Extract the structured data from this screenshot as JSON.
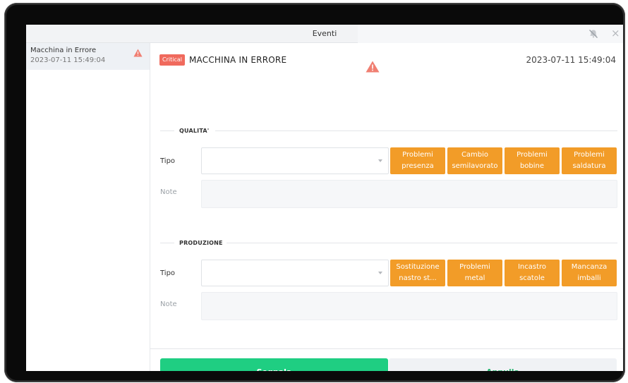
{
  "window": {
    "title": "Eventi"
  },
  "sidebar": {
    "items": [
      {
        "name": "Macchina in Errore",
        "time": "2023-07-11 15:49:04"
      }
    ]
  },
  "event": {
    "badge": "Critical",
    "title": "MACCHINA IN ERRORE",
    "time": "2023-07-11 15:49:04"
  },
  "quality": {
    "section": "QUALITA'",
    "type_label": "Tipo",
    "type_value": "",
    "note_label": "Note",
    "note_value": "",
    "buttons": [
      {
        "label": "Problemi presenza"
      },
      {
        "label": "Cambio semilavorato"
      },
      {
        "label": "Problemi bobine"
      },
      {
        "label": "Problemi saldatura"
      }
    ]
  },
  "production": {
    "section": "PRODUZIONE",
    "type_label": "Tipo",
    "type_value": "",
    "note_label": "Note",
    "note_value": "",
    "buttons": [
      {
        "label": "Sostituzione nastro st..."
      },
      {
        "label": "Problemi metal"
      },
      {
        "label": "Incastro scatole"
      },
      {
        "label": "Mancanza imballi"
      }
    ]
  },
  "actions": {
    "submit": "Segnala",
    "cancel": "Annulla"
  },
  "colors": {
    "accent_orange": "#f29c28",
    "critical_red": "#f06a5d",
    "submit_green": "#1fce82"
  }
}
